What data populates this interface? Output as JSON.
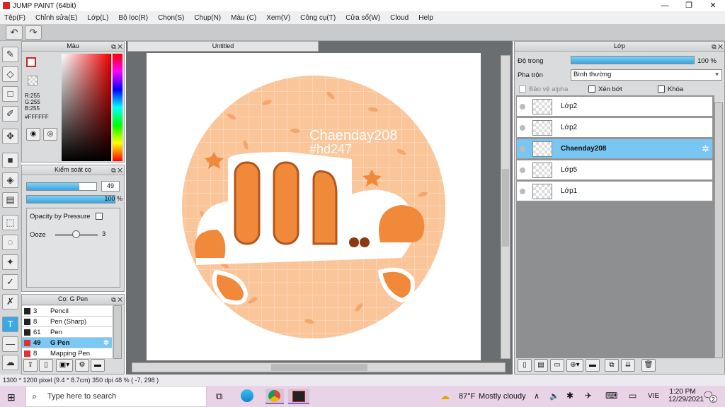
{
  "window": {
    "title": "JUMP PAINT (64bit)",
    "minimize": "—",
    "maximize": "❐",
    "close": "✕"
  },
  "menu": [
    "Tệp(F)",
    "Chỉnh sửa(E)",
    "Lớp(L)",
    "Bộ lọc(R)",
    "Chọn(S)",
    "Chụp(N)",
    "Màu (C)",
    "Xem(V)",
    "Công cụ(T)",
    "Cửa sổ(W)",
    "Cloud",
    "Help"
  ],
  "toolbar": {
    "undo": "↶",
    "redo": "↷"
  },
  "color_panel": {
    "title": "Màu",
    "rgb": "R:255\nG:255\nB:255",
    "r": "R:255",
    "g": "G:255",
    "b": "B:255",
    "hex": "#FFFFFF"
  },
  "brush_control": {
    "title": "Kiểm soát cọ",
    "size_value": "49",
    "opacity_value": "100 %",
    "opacity_by_pressure": "Opacity by Pressure",
    "ooze_label": "Ooze",
    "ooze_value": "3",
    "size_fill": 0.75,
    "opacity_fill": 1.0,
    "ooze_fill": 0.5
  },
  "brush_list": {
    "title": "Cọ: G Pen",
    "items": [
      {
        "size": "3",
        "name": "Pencil",
        "color": "#222222",
        "selected": false
      },
      {
        "size": "8",
        "name": "Pen (Sharp)",
        "color": "#222222",
        "selected": false
      },
      {
        "size": "61",
        "name": "Pen",
        "color": "#222222",
        "selected": false
      },
      {
        "size": "49",
        "name": "G Pen",
        "color": "#e03030",
        "selected": true
      },
      {
        "size": "8",
        "name": "Mapping Pen",
        "color": "#e03030",
        "selected": false
      }
    ]
  },
  "canvas": {
    "tab_title": "Untitled",
    "watermark1": "Chaenday208",
    "watermark2": "#hd247"
  },
  "layers_panel": {
    "title": "Lớp",
    "opacity_label": "Độ trong",
    "opacity_value": "100 %",
    "blend_label": "Pha trộn",
    "blend_value": "Bình thường",
    "protect_alpha": "Bảo vệ alpha",
    "clipping": "Xén bớt",
    "lock": "Khóa",
    "layers": [
      {
        "name": "Lớp2",
        "selected": false
      },
      {
        "name": "Lớp2",
        "selected": false
      },
      {
        "name": "Chaenday208",
        "selected": true
      },
      {
        "name": "Lớp5",
        "selected": false
      },
      {
        "name": "Lớp1",
        "selected": false
      }
    ]
  },
  "status": {
    "text": "1300 * 1200 pixel  (9.4 * 8.7cm)  350 dpi  48 %  ( -7, 298 )"
  },
  "taskbar": {
    "search_placeholder": "Type here to search",
    "weather_temp": "87°F",
    "weather_text": "Mostly cloudy",
    "lang": "VIE",
    "time": "1:20 PM",
    "date": "12/29/2021",
    "notif_count": "2"
  },
  "colors": {
    "accent": "#3aa5df",
    "canvas_bg": "#6b6e70",
    "art_orange": "#f08a3a",
    "art_peach": "#fbc59a"
  }
}
